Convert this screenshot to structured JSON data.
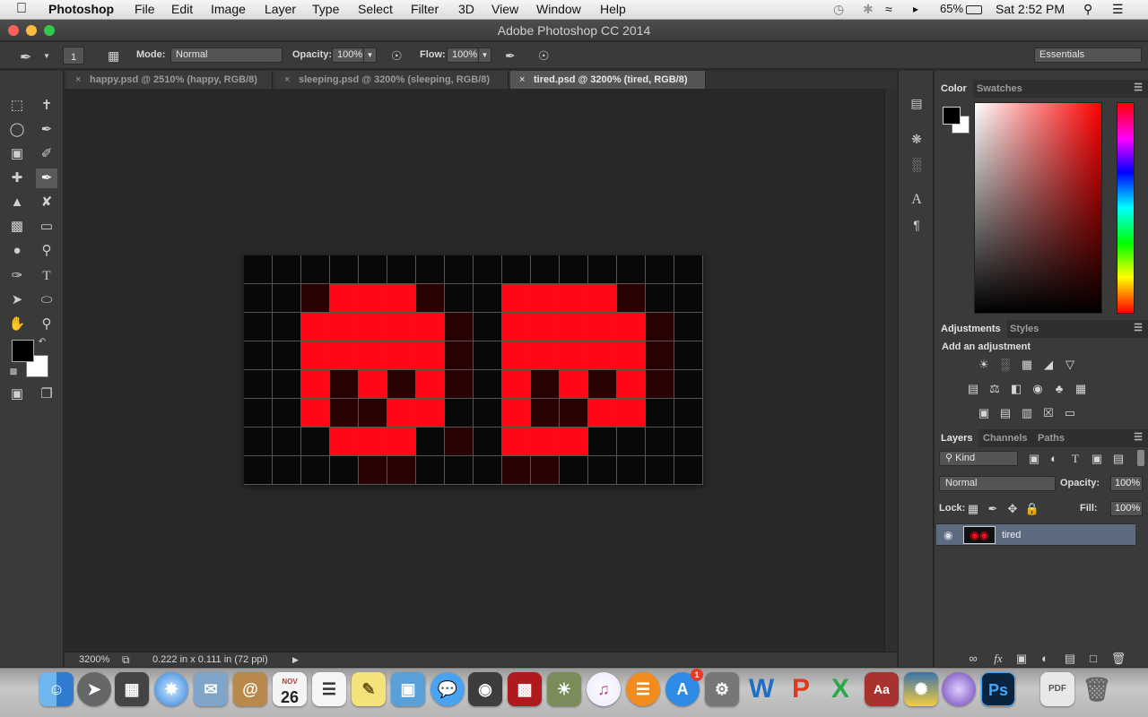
{
  "menubar": {
    "apple_icon": "apple-icon",
    "app_name": "Photoshop",
    "items": [
      "File",
      "Edit",
      "Image",
      "Layer",
      "Type",
      "Select",
      "Filter",
      "3D",
      "View",
      "Window",
      "Help"
    ],
    "battery": "65%",
    "clock": "Sat 2:52 PM"
  },
  "window": {
    "title": "Adobe Photoshop CC 2014"
  },
  "options": {
    "brush_size": "1",
    "mode_label": "Mode:",
    "mode_value": "Normal",
    "opacity_label": "Opacity:",
    "opacity_value": "100%",
    "flow_label": "Flow:",
    "flow_value": "100%",
    "workspace": "Essentials"
  },
  "tabs": [
    {
      "label": "happy.psd @ 2510% (happy, RGB/8)"
    },
    {
      "label": "sleeping.psd @ 3200% (sleeping, RGB/8)"
    },
    {
      "label": "tired.psd @ 3200% (tired, RGB/8)"
    }
  ],
  "status": {
    "zoom": "3200%",
    "doc_size": "0.222 in x 0.111 in (72 ppi)"
  },
  "colors": {
    "pixel_red": "#ff0718",
    "pixel_dark_red": "#2a0204",
    "pixel_black": "#080808",
    "foreground": "#000000",
    "background": "#ffffff"
  },
  "canvas_pixels": [
    "0000000000000000",
    "00dRRRd00RRRRd00",
    "00RRRRRd0RRRRRd0",
    "00RRRRRd0RRRRRd0",
    "00RdRdRd0RdRdRd0",
    "00RddRR00RddRR00",
    "000RRR0d0RRR0000",
    "0000dd000dd00000"
  ],
  "color_panel": {
    "tabs": [
      "Color",
      "Swatches"
    ]
  },
  "adjustments_panel": {
    "tabs": [
      "Adjustments",
      "Styles"
    ],
    "heading": "Add an adjustment"
  },
  "layers_panel": {
    "tabs": [
      "Layers",
      "Channels",
      "Paths"
    ],
    "filter": "Kind",
    "blend_mode": "Normal",
    "opacity_label": "Opacity:",
    "opacity_value": "100%",
    "lock_label": "Lock:",
    "fill_label": "Fill:",
    "fill_value": "100%",
    "layers": [
      {
        "name": "tired"
      }
    ]
  },
  "dock": {
    "calendar_month": "NOV",
    "calendar_day": "26",
    "appstore_badge": "1",
    "apps": [
      "finder",
      "launchpad",
      "mission-control",
      "safari",
      "mail-bird",
      "contacts",
      "calendar",
      "reminders",
      "notes",
      "preview",
      "messages",
      "facetime",
      "photo-booth",
      "iphoto",
      "itunes",
      "ibooks",
      "app-store",
      "system-preferences",
      "word",
      "powerpoint",
      "excel",
      "dictionary",
      "python",
      "nebula",
      "photoshop",
      "pdf",
      "trash"
    ]
  }
}
